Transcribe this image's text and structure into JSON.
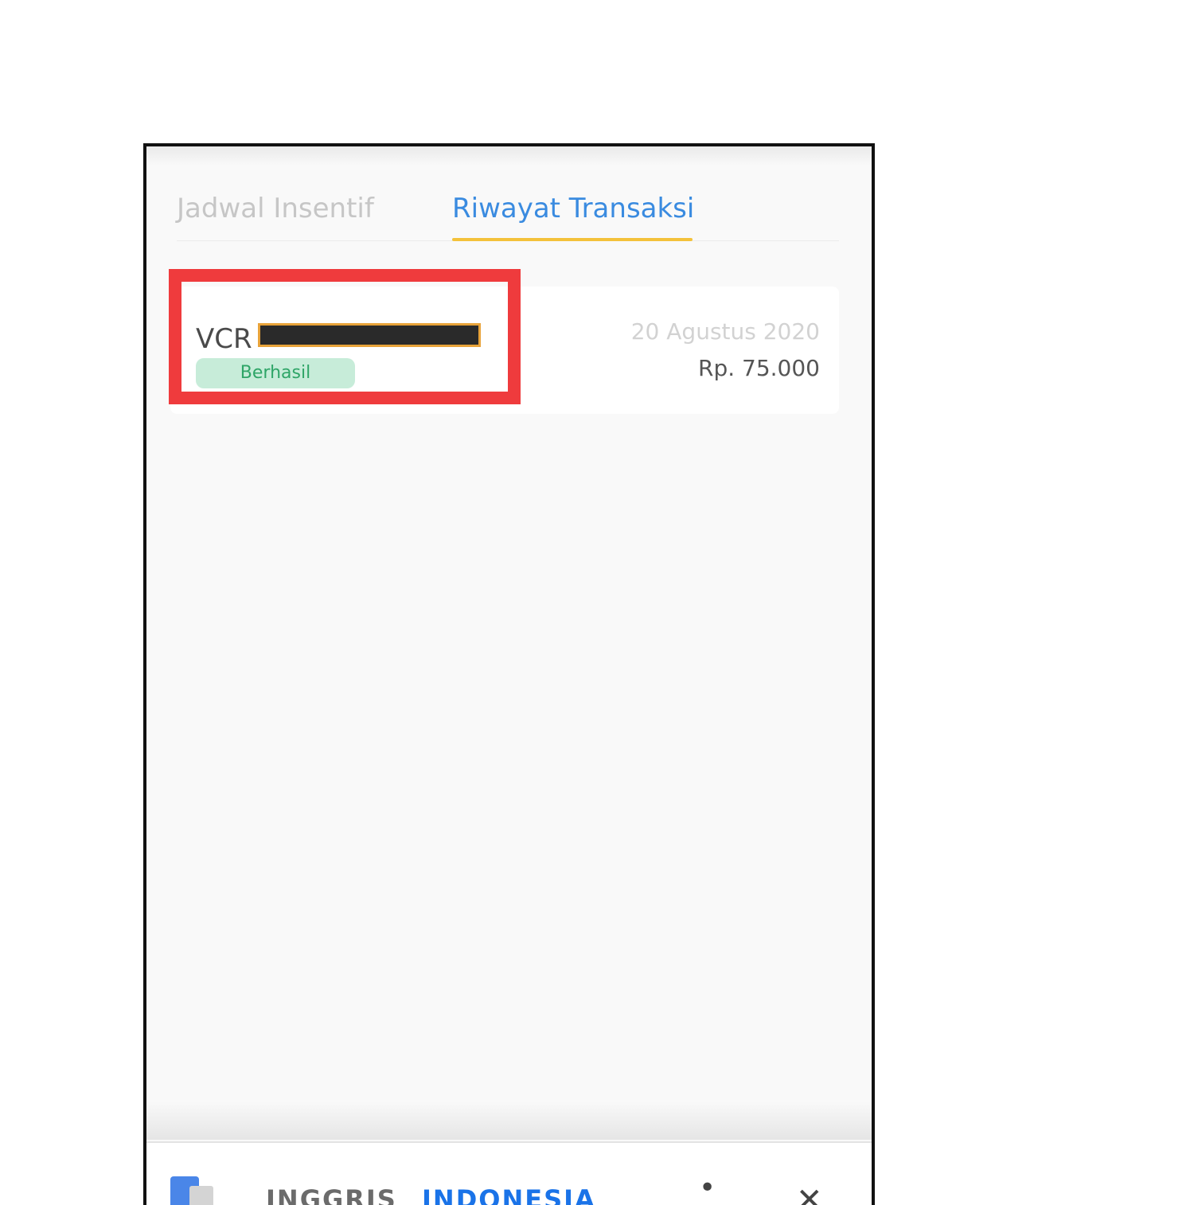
{
  "tabs": {
    "incentive_schedule": "Jadwal Insentif",
    "transaction_history": "Riwayat Transaksi"
  },
  "transaction": {
    "id_prefix": "VCR",
    "status": "Berhasil",
    "date": "20 Agustus 2020",
    "amount": "Rp. 75.000"
  },
  "translate_bar": {
    "source_language": "INGGRIS",
    "target_language": "INDONESIA",
    "icons": [
      "google-translate-icon",
      "more-vert-icon",
      "close-icon"
    ]
  },
  "colors": {
    "accent_blue": "#3a8be0",
    "tab_underline": "#f4c23b",
    "highlight_red": "#ef3b3d",
    "success_badge_bg": "#c7ecd9",
    "success_badge_text": "#2ea567"
  }
}
